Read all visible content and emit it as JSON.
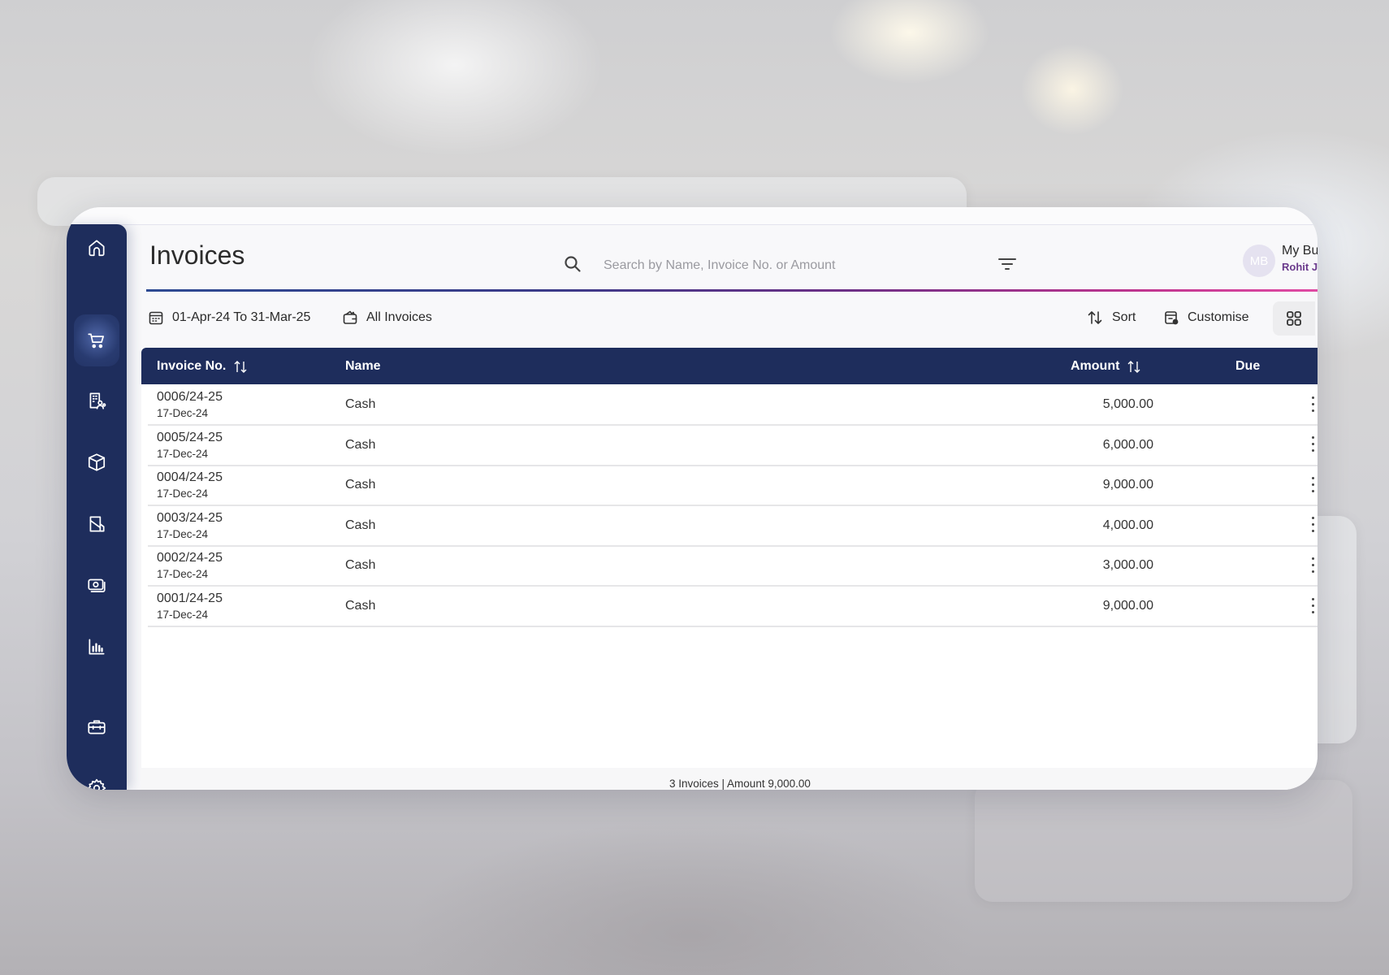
{
  "page": {
    "title": "Invoices"
  },
  "search": {
    "placeholder": "Search by Name, Invoice No. or Amount",
    "value": ""
  },
  "profile": {
    "initials": "MB",
    "business_name": "My Business",
    "user_name": "Rohit Jha"
  },
  "sidebar": {
    "items": [
      {
        "name": "home",
        "icon": "home-icon",
        "active": false
      },
      {
        "name": "sales",
        "icon": "cart-icon",
        "active": true
      },
      {
        "name": "parties",
        "icon": "building-users-icon",
        "active": false
      },
      {
        "name": "items",
        "icon": "box-icon",
        "active": false
      },
      {
        "name": "purchases",
        "icon": "document-fold-icon",
        "active": false
      },
      {
        "name": "cash-bank",
        "icon": "money-icon",
        "active": false
      },
      {
        "name": "reports",
        "icon": "bar-chart-icon",
        "active": false
      },
      {
        "name": "business",
        "icon": "briefcase-icon",
        "active": false
      },
      {
        "name": "settings",
        "icon": "gear-icon",
        "active": false
      }
    ]
  },
  "toolbar": {
    "date_range": "01-Apr-24 To 31-Mar-25",
    "invoice_filter": "All Invoices",
    "sort_label": "Sort",
    "customise_label": "Customise"
  },
  "table": {
    "columns": {
      "invoice_no": "Invoice No.",
      "name": "Name",
      "amount": "Amount",
      "due": "Due"
    },
    "rows": [
      {
        "invoice_no": "0006/24-25",
        "date": "17-Dec-24",
        "name": "Cash",
        "amount": "5,000.00",
        "due": ""
      },
      {
        "invoice_no": "0005/24-25",
        "date": "17-Dec-24",
        "name": "Cash",
        "amount": "6,000.00",
        "due": ""
      },
      {
        "invoice_no": "0004/24-25",
        "date": "17-Dec-24",
        "name": "Cash",
        "amount": "9,000.00",
        "due": ""
      },
      {
        "invoice_no": "0003/24-25",
        "date": "17-Dec-24",
        "name": "Cash",
        "amount": "4,000.00",
        "due": ""
      },
      {
        "invoice_no": "0002/24-25",
        "date": "17-Dec-24",
        "name": "Cash",
        "amount": "3,000.00",
        "due": ""
      },
      {
        "invoice_no": "0001/24-25",
        "date": "17-Dec-24",
        "name": "Cash",
        "amount": "9,000.00",
        "due": ""
      }
    ]
  },
  "footer": {
    "summary": "3 Invoices | Amount 9,000.00"
  },
  "colors": {
    "primary": "#1e2d5c",
    "accent_purple": "#6a3a8c",
    "accent_pink": "#e04aa3"
  }
}
